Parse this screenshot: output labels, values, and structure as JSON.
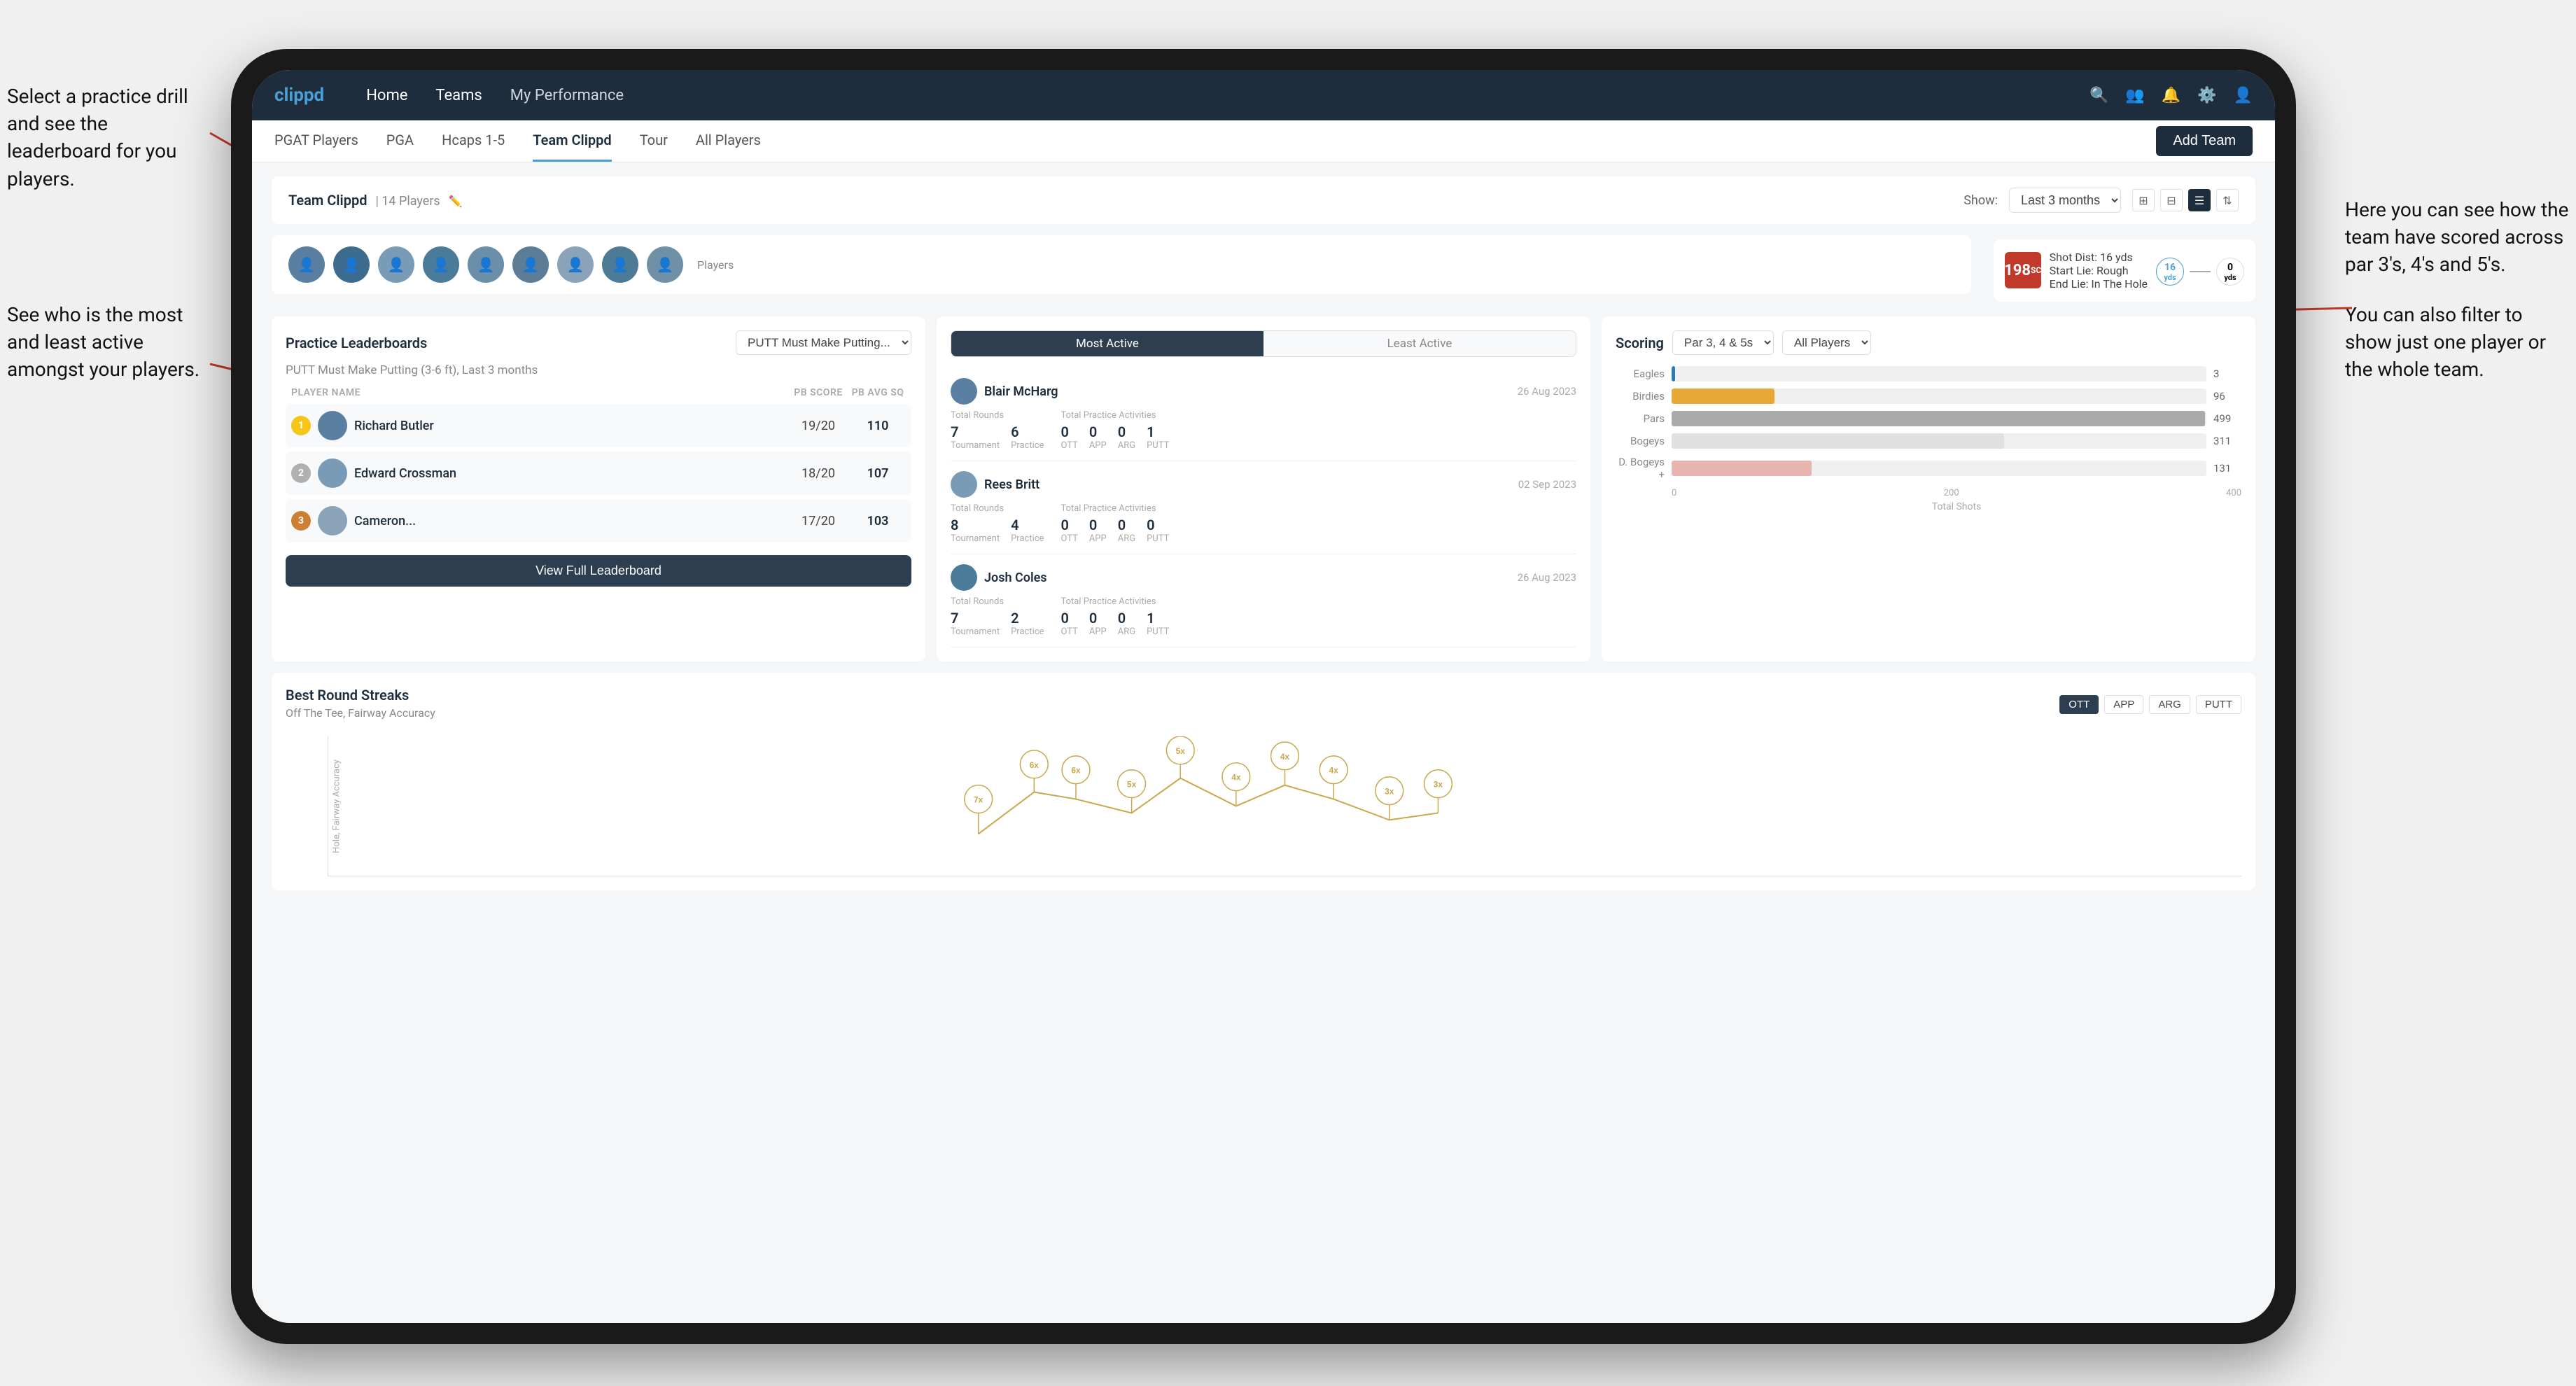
{
  "annotations": {
    "left1": "Select a practice drill and see the leaderboard for you players.",
    "left2": "See who is the most and least active amongst your players.",
    "right1": "Here you can see how the team have scored across par 3's, 4's and 5's.",
    "right2": "You can also filter to show just one player or the whole team."
  },
  "nav": {
    "logo": "clippd",
    "items": [
      "Home",
      "Teams",
      "My Performance"
    ],
    "active": "Teams",
    "icons": [
      "🔍",
      "👤",
      "🔔",
      "⚙️",
      "👤"
    ]
  },
  "sub_nav": {
    "items": [
      "PGAT Players",
      "PGA",
      "Hcaps 1-5",
      "Team Clippd",
      "Tour",
      "All Players"
    ],
    "active": "Team Clippd",
    "add_team_label": "Add Team"
  },
  "team_header": {
    "title": "Team Clippd",
    "count": "14 Players",
    "show_label": "Show:",
    "show_value": "Last 3 months",
    "view_options": [
      "grid-small",
      "grid-large",
      "list",
      "filter"
    ]
  },
  "players": {
    "label": "Players",
    "count": 9,
    "colors": [
      "color1",
      "color2",
      "color3",
      "color4",
      "color5",
      "color6",
      "color7",
      "color8",
      "color9"
    ]
  },
  "shot_card": {
    "badge": "198",
    "badge_sub": "SC",
    "dist_label": "Shot Dist: 16 yds",
    "start_lie": "Start Lie: Rough",
    "end_lie": "End Lie: In The Hole",
    "yds_from": "16",
    "yds_from_label": "yds",
    "yds_to": "0",
    "yds_to_label": "yds"
  },
  "leaderboard": {
    "title": "Practice Leaderboards",
    "drill_select": "PUTT Must Make Putting...",
    "subtitle": "PUTT Must Make Putting (3-6 ft),",
    "subtitle_range": "Last 3 months",
    "col_player": "PLAYER NAME",
    "col_score": "PB SCORE",
    "col_avg": "PB AVG SQ",
    "players": [
      {
        "rank": 1,
        "rank_type": "gold",
        "name": "Richard Butler",
        "score": "19/20",
        "avg": "110"
      },
      {
        "rank": 2,
        "rank_type": "silver",
        "name": "Edward Crossman",
        "score": "18/20",
        "avg": "107"
      },
      {
        "rank": 3,
        "rank_type": "bronze",
        "name": "Cameron...",
        "score": "17/20",
        "avg": "103"
      }
    ],
    "view_full_label": "View Full Leaderboard"
  },
  "activity": {
    "tab_most": "Most Active",
    "tab_least": "Least Active",
    "active_tab": "Most Active",
    "players": [
      {
        "name": "Blair McHarg",
        "date": "26 Aug 2023",
        "total_rounds_label": "Total Rounds",
        "tournament": "7",
        "tournament_label": "Tournament",
        "practice": "6",
        "practice_label": "Practice",
        "total_practice_label": "Total Practice Activities",
        "ott": "0",
        "app": "0",
        "arg": "0",
        "putt": "1"
      },
      {
        "name": "Rees Britt",
        "date": "02 Sep 2023",
        "total_rounds_label": "Total Rounds",
        "tournament": "8",
        "tournament_label": "Tournament",
        "practice": "4",
        "practice_label": "Practice",
        "total_practice_label": "Total Practice Activities",
        "ott": "0",
        "app": "0",
        "arg": "0",
        "putt": "0"
      },
      {
        "name": "Josh Coles",
        "date": "26 Aug 2023",
        "total_rounds_label": "Total Rounds",
        "tournament": "7",
        "tournament_label": "Tournament",
        "practice": "2",
        "practice_label": "Practice",
        "total_practice_label": "Total Practice Activities",
        "ott": "0",
        "app": "0",
        "arg": "0",
        "putt": "1"
      }
    ]
  },
  "scoring": {
    "title": "Scoring",
    "par_filter": "Par 3, 4 & 5s",
    "player_filter": "All Players",
    "bars": [
      {
        "label": "Eagles",
        "value": 3,
        "max": 500,
        "color": "bar-eagles"
      },
      {
        "label": "Birdies",
        "value": 96,
        "max": 500,
        "color": "bar-birdies"
      },
      {
        "label": "Pars",
        "value": 499,
        "max": 500,
        "color": "bar-pars"
      },
      {
        "label": "Bogeys",
        "value": 311,
        "max": 500,
        "color": "bar-bogeys"
      },
      {
        "label": "D. Bogeys +",
        "value": 131,
        "max": 500,
        "color": "bar-dbogeys"
      }
    ],
    "x_axis": [
      "0",
      "200",
      "400"
    ],
    "x_label": "Total Shots"
  },
  "best_rounds": {
    "title": "Best Round Streaks",
    "subtitle": "Off The Tee, Fairway Accuracy",
    "buttons": [
      "OTT",
      "APP",
      "ARG",
      "PUTT"
    ],
    "active_btn": "OTT",
    "y_label": "Hole, Fairway Accuracy",
    "points": [
      {
        "x": 6,
        "y": 30,
        "label": "7x"
      },
      {
        "x": 14,
        "y": 60,
        "label": "6x"
      },
      {
        "x": 20,
        "y": 55,
        "label": "6x"
      },
      {
        "x": 28,
        "y": 45,
        "label": "5x"
      },
      {
        "x": 35,
        "y": 70,
        "label": "5x"
      },
      {
        "x": 43,
        "y": 50,
        "label": "4x"
      },
      {
        "x": 50,
        "y": 65,
        "label": "4x"
      },
      {
        "x": 57,
        "y": 55,
        "label": "4x"
      },
      {
        "x": 65,
        "y": 40,
        "label": "3x"
      },
      {
        "x": 72,
        "y": 45,
        "label": "3x"
      }
    ]
  }
}
